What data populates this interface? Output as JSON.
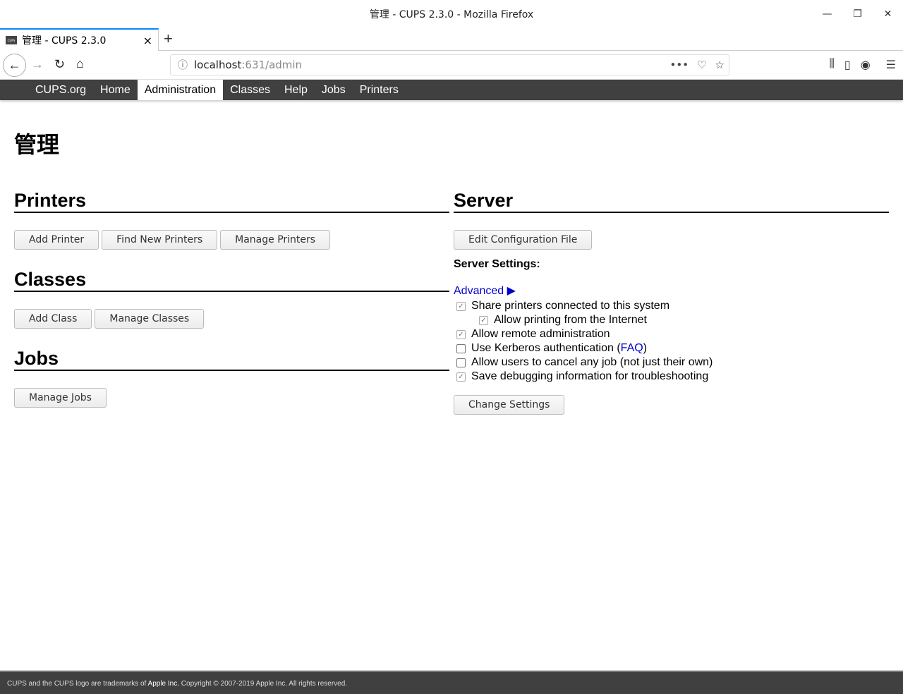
{
  "window": {
    "title": "管理 - CUPS 2.3.0 - Mozilla Firefox",
    "minimize": "—",
    "restore": "❐",
    "close": "✕"
  },
  "tab": {
    "title": "管理 - CUPS 2.3.0",
    "favicon": "CUPS",
    "close": "×",
    "new": "+"
  },
  "browser": {
    "url_host": "localhost",
    "url_rest": ":631/admin"
  },
  "nav": [
    "CUPS.org",
    "Home",
    "Administration",
    "Classes",
    "Help",
    "Jobs",
    "Printers"
  ],
  "page_title": "管理",
  "printers": {
    "title": "Printers",
    "buttons": [
      "Add Printer",
      "Find New Printers",
      "Manage Printers"
    ]
  },
  "classes": {
    "title": "Classes",
    "buttons": [
      "Add Class",
      "Manage Classes"
    ]
  },
  "jobs": {
    "title": "Jobs",
    "buttons": [
      "Manage Jobs"
    ]
  },
  "server": {
    "title": "Server",
    "edit": "Edit Configuration File",
    "settings_label": "Server Settings:",
    "advanced": "Advanced ▶",
    "options": [
      {
        "label": "Share printers connected to this system",
        "checked": true
      },
      {
        "label": "Allow printing from the Internet",
        "checked": true
      },
      {
        "label": "Allow remote administration",
        "checked": true
      },
      {
        "label": "Use Kerberos authentication (",
        "link": "FAQ",
        "after": ")",
        "checked": false
      },
      {
        "label": "Allow users to cancel any job (not just their own)",
        "checked": false
      },
      {
        "label": "Save debugging information for troubleshooting",
        "checked": true
      }
    ],
    "change": "Change Settings"
  },
  "footer": {
    "t1": "CUPS and the CUPS logo are trademarks of ",
    "apple": "Apple Inc.",
    "t2": " Copyright © 2007-2019 Apple Inc. All rights reserved."
  }
}
